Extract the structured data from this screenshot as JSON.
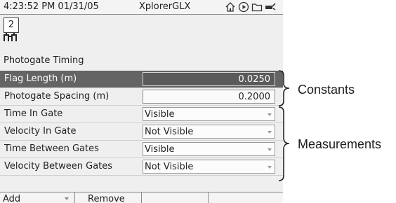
{
  "statusbar": {
    "time": "4:23:52 PM  01/31/05",
    "app_name": "XplorerGLX"
  },
  "app_icon": {
    "number": "2"
  },
  "screen_title": "Photogate Timing",
  "constants": [
    {
      "label": "Flag Length (m)",
      "value": "0.0250",
      "selected": true
    },
    {
      "label": "Photogate Spacing (m)",
      "value": "0.2000",
      "selected": false
    }
  ],
  "measurements": [
    {
      "label": "Time In Gate",
      "value": "Visible"
    },
    {
      "label": "Velocity In Gate",
      "value": "Not Visible"
    },
    {
      "label": "Time Between Gates",
      "value": "Visible"
    },
    {
      "label": "Velocity Between Gates",
      "value": "Not Visible"
    }
  ],
  "toolbar": {
    "add_label": "Add",
    "remove_label": "Remove"
  },
  "annotations": {
    "constants": "Constants",
    "measurements": "Measurements"
  },
  "icons": [
    "home-icon",
    "play-icon",
    "folder-icon",
    "battery-plug-icon",
    "photogate-icon"
  ]
}
